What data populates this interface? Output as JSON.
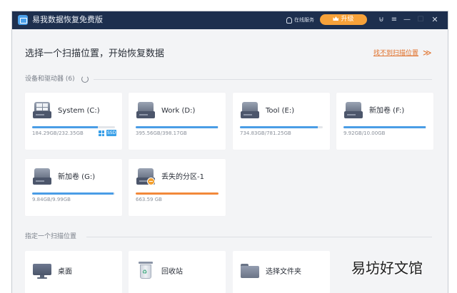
{
  "titlebar": {
    "app_title": "易我数据恢复免费版",
    "service_label": "在线服务",
    "upgrade_label": "升级"
  },
  "main": {
    "heading": "选择一个扫描位置，开始恢复数据",
    "help_link": "找不到扫描位置",
    "help_arrow": "≫"
  },
  "devices_section": {
    "label": "设备和驱动器 (6)",
    "drives": [
      {
        "name": "System (C:)",
        "size_text": "184.29GB/232.35GB",
        "usage": 0.79,
        "windows_badge": true,
        "ssd_badge": "SSD"
      },
      {
        "name": "Work (D:)",
        "size_text": "395.56GB/398.17GB",
        "usage": 0.99
      },
      {
        "name": "Tool (E:)",
        "size_text": "734.83GB/781.25GB",
        "usage": 0.94
      },
      {
        "name": "新加卷 (F:)",
        "size_text": "9.92GB/10.00GB",
        "usage": 0.99
      },
      {
        "name": "新加卷 (G:)",
        "size_text": "9.84GB/9.99GB",
        "usage": 0.98
      },
      {
        "name": "丢失的分区-1",
        "size_text": "663.59 GB",
        "usage": 1.0,
        "lost": true
      }
    ]
  },
  "locations_section": {
    "label": "指定一个扫描位置",
    "items": [
      {
        "name": "桌面",
        "icon": "monitor-icon"
      },
      {
        "name": "回收站",
        "icon": "recycle-bin-icon"
      },
      {
        "name": "选择文件夹",
        "icon": "folder-icon"
      }
    ]
  },
  "watermark": "易坊好文馆",
  "colors": {
    "titlebar": "#1d2f4e",
    "upgrade": "#f7a23a",
    "accent_link": "#e0702a",
    "usage_bar": "#4a9de6",
    "lost_bar": "#f2893a"
  }
}
